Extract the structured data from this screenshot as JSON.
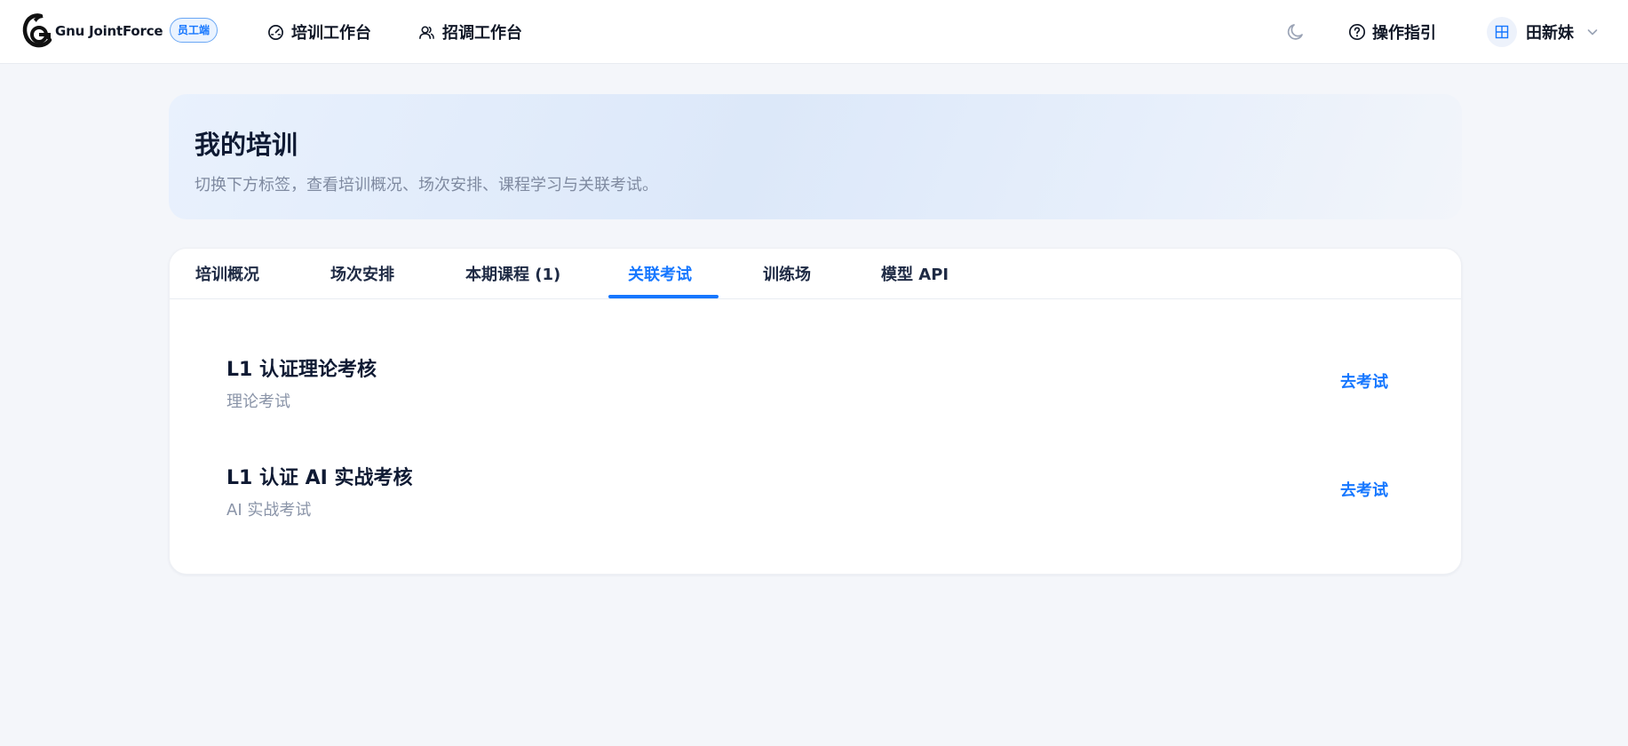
{
  "header": {
    "brand": "Gnu JointForce",
    "role_badge": "员工端",
    "nav": [
      {
        "label": "培训工作台",
        "icon": "dashboard-icon"
      },
      {
        "label": "招调工作台",
        "icon": "users-icon"
      }
    ],
    "theme_icon": "moon-icon",
    "help_label": "操作指引",
    "help_icon": "question-circle-icon",
    "user": {
      "name": "田新妹",
      "avatar_icon": "grid-icon"
    }
  },
  "hero": {
    "title": "我的培训",
    "subtitle": "切换下方标签，查看培训概况、场次安排、课程学习与关联考试。"
  },
  "tabs": [
    {
      "label": "培训概况",
      "active": false
    },
    {
      "label": "场次安排",
      "active": false
    },
    {
      "label": "本期课程 (1)",
      "active": false
    },
    {
      "label": "关联考试",
      "active": true
    },
    {
      "label": "训练场",
      "active": false
    },
    {
      "label": "模型 API",
      "active": false
    }
  ],
  "exams": [
    {
      "title": "L1 认证理论考核",
      "type": "理论考试",
      "action": "去考试"
    },
    {
      "title": "L1 认证 AI 实战考核",
      "type": "AI 实战考试",
      "action": "去考试"
    }
  ],
  "colors": {
    "accent": "#1677ff",
    "page_bg": "#f4f6fa",
    "text_primary": "#0f1a33",
    "text_muted": "#8a94a8"
  }
}
